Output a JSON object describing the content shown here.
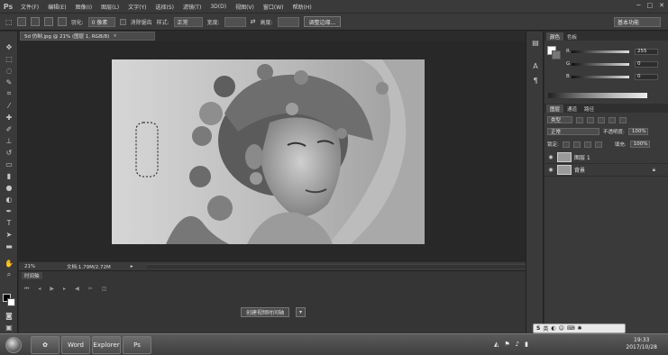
{
  "menu": {
    "logo": "Ps",
    "items": [
      "文件(F)",
      "编辑(E)",
      "图像(I)",
      "图层(L)",
      "文字(Y)",
      "选择(S)",
      "滤镜(T)",
      "3D(D)",
      "视图(V)",
      "窗口(W)",
      "帮助(H)"
    ]
  },
  "options": {
    "feather_label": "羽化:",
    "feather_value": "0 像素",
    "antialias_label": "消除锯齿",
    "style_label": "样式:",
    "style_value": "正常",
    "width_label": "宽度:",
    "height_label": "高度:",
    "refine_button": "调整边缘...",
    "workspace": "基本功能"
  },
  "document": {
    "tab_title": "5d 仿制.jpg @ 21% (图层 1, RGB/8)",
    "zoom": "21%",
    "doc_info": "文档:1.79M/2.72M"
  },
  "timeline": {
    "tab": "时间轴",
    "create_button": "创建视频时间轴"
  },
  "color_panel": {
    "tabs": [
      "颜色",
      "色板"
    ],
    "channels": [
      {
        "label": "R",
        "value": "255"
      },
      {
        "label": "G",
        "value": "0"
      },
      {
        "label": "B",
        "value": "0"
      }
    ]
  },
  "layers_panel": {
    "tabs": [
      "图层",
      "通道",
      "路径"
    ],
    "kind_label": "类型",
    "blend_mode": "正常",
    "opacity_label": "不透明度:",
    "opacity_value": "100%",
    "lock_label": "锁定:",
    "fill_label": "填充:",
    "fill_value": "100%",
    "layers": [
      {
        "name": "图层 1",
        "locked": false
      },
      {
        "name": "背景",
        "locked": true
      }
    ]
  },
  "taskbar": {
    "apps": [
      "Word",
      "Explorer",
      "Ps"
    ],
    "ime": "英",
    "time": "19:33",
    "date": "2017/10/28"
  }
}
